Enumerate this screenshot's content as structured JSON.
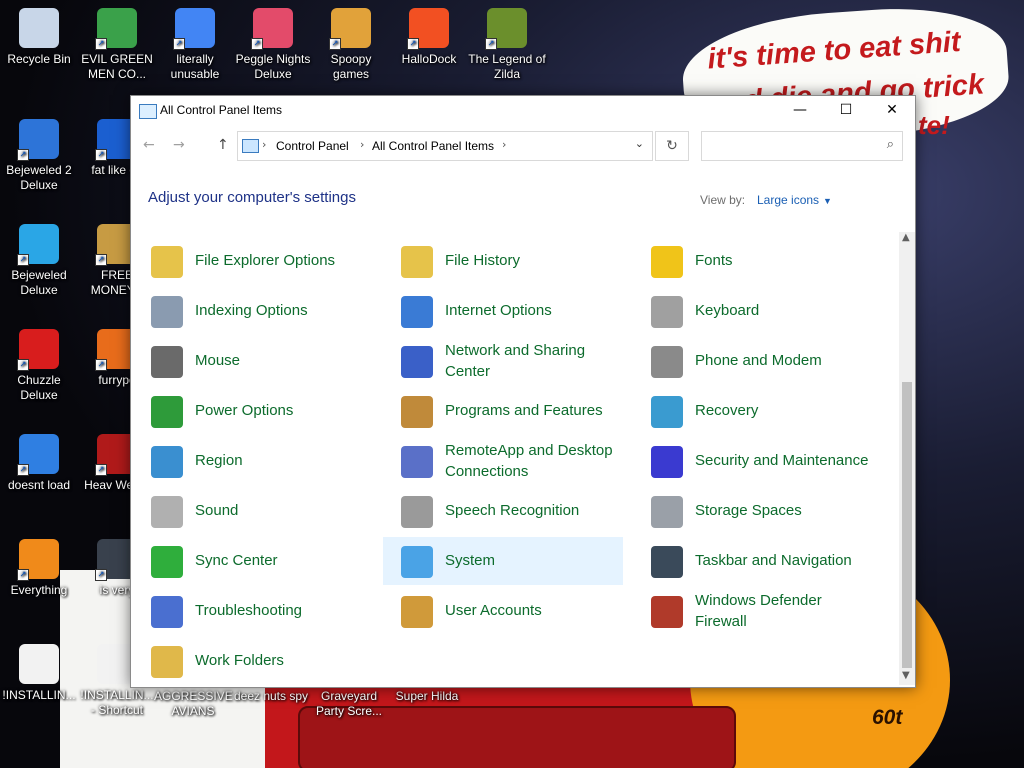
{
  "desktop": {
    "icons": [
      {
        "label": "Recycle Bin",
        "color": "#c8d6e8"
      },
      {
        "label": "EVIL GREEN MEN CO...",
        "color": "#3aa14a"
      },
      {
        "label": "literally unusable",
        "color": "#4285f4"
      },
      {
        "label": "Peggle Nights Deluxe",
        "color": "#e34b6a"
      },
      {
        "label": "Spoopy games",
        "color": "#e1a23a"
      },
      {
        "label": "HalloDock",
        "color": "#f25022"
      },
      {
        "label": "The Legend of Zilda",
        "color": "#6b8f2c"
      },
      {
        "label": "Bejeweled 2 Deluxe",
        "color": "#2d74d8"
      },
      {
        "label": "fat like da",
        "color": "#1b5fd0"
      },
      {
        "label": "Bejeweled Deluxe",
        "color": "#2aa6e6"
      },
      {
        "label": "FREE MONEY.e",
        "color": "#c79b43"
      },
      {
        "label": "Chuzzle Deluxe",
        "color": "#d81d1d"
      },
      {
        "label": "furrypo",
        "color": "#e86c1b"
      },
      {
        "label": "doesnt load",
        "color": "#2f7fe2"
      },
      {
        "label": "Heav Weap.",
        "color": "#b01a1a"
      },
      {
        "label": "Everything",
        "color": "#f08a1a"
      },
      {
        "label": "is very",
        "color": "#39414d"
      },
      {
        "label": "!INSTALLIN...",
        "color": "#f2f2f2"
      },
      {
        "label": "!INSTALLIN... - Shortcut",
        "color": "#f2f2f2"
      }
    ],
    "bottom_labels": [
      "AGGRESSIVE AVIANS",
      "deez nuts spy",
      "Graveyard Party Scre...",
      "Super Hilda"
    ],
    "speech_lines": [
      "it's time to eat shit",
      "and die and go trick",
      "te!"
    ],
    "wallpaper_tag": "60t"
  },
  "window": {
    "title": "All Control Panel Items",
    "controls": {
      "minimize": "—",
      "maximize": "☐",
      "close": "✕"
    },
    "nav": {
      "back": "←",
      "forward": "→",
      "up": "↑"
    },
    "address": {
      "crumbs": [
        "Control Panel",
        "All Control Panel Items"
      ],
      "separator": "›",
      "dropdown": "⌄"
    },
    "refresh": "↻",
    "search": {
      "placeholder": "",
      "icon": "search-icon"
    },
    "heading": "Adjust your computer's settings",
    "view_by_label": "View by:",
    "view_by_value": "Large icons",
    "view_by_caret": "▼",
    "items": [
      [
        "File Explorer Options",
        "File History",
        "Fonts"
      ],
      [
        "Indexing Options",
        "Internet Options",
        "Keyboard"
      ],
      [
        "Mouse",
        "Network and Sharing Center",
        "Phone and Modem"
      ],
      [
        "Power Options",
        "Programs and Features",
        "Recovery"
      ],
      [
        "Region",
        "RemoteApp and Desktop Connections",
        "Security and Maintenance"
      ],
      [
        "Sound",
        "Speech Recognition",
        "Storage Spaces"
      ],
      [
        "Sync Center",
        "System",
        "Taskbar and Navigation"
      ],
      [
        "Troubleshooting",
        "User Accounts",
        "Windows Defender Firewall"
      ],
      [
        "Work Folders"
      ]
    ],
    "selected_item": "System",
    "accent": "#0c6b2c"
  }
}
